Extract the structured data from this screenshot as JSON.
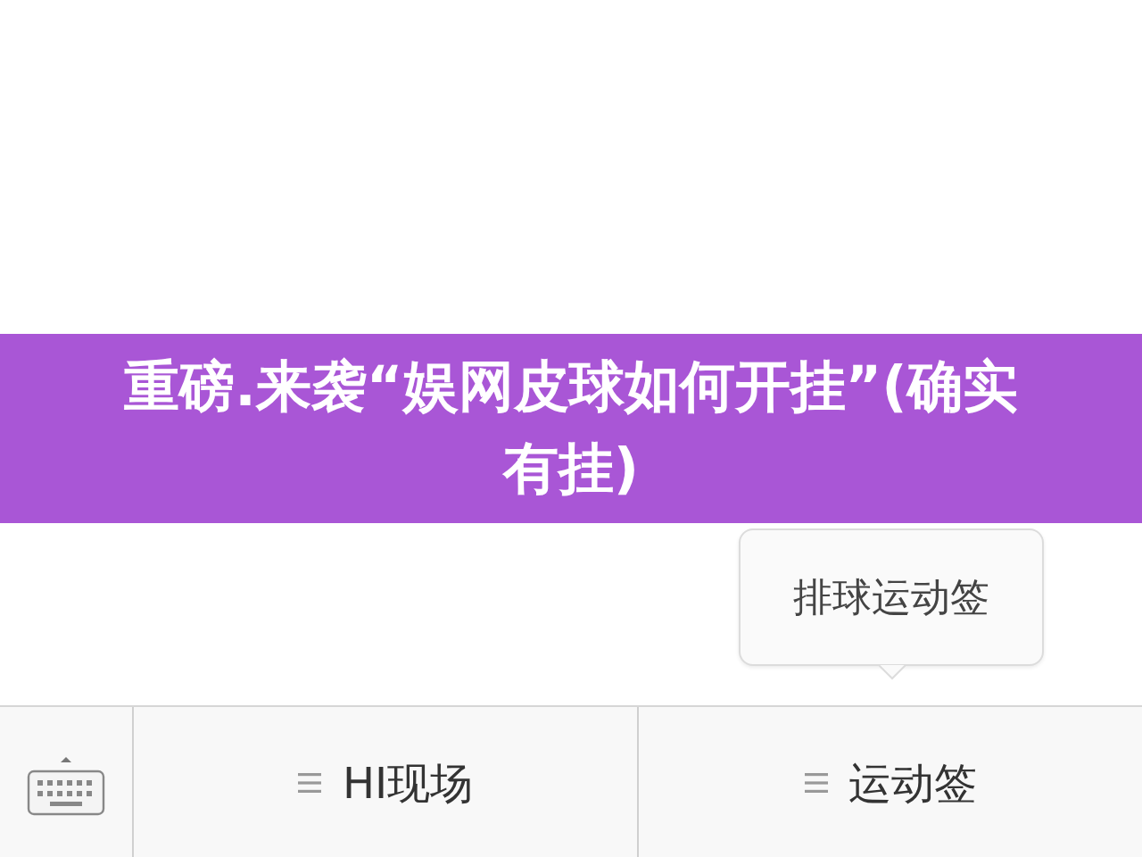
{
  "banner": {
    "title": "重磅.来袭“娱网皮球如何开挂”(确实有挂)"
  },
  "tooltip": {
    "text": "排球运动签"
  },
  "menu_bar": {
    "items": [
      {
        "label": "HI现场"
      },
      {
        "label": "运动签"
      }
    ]
  }
}
